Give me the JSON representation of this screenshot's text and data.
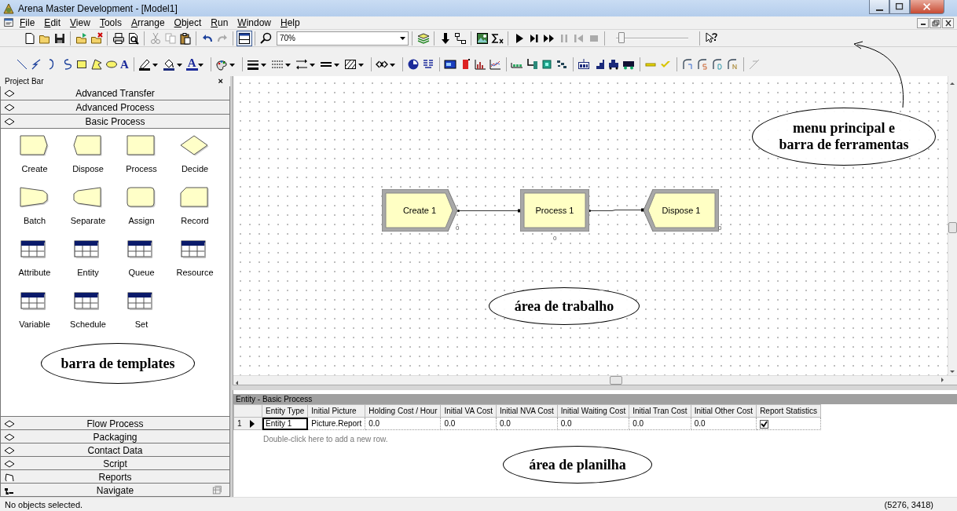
{
  "window": {
    "title": "Arena Master Development - [Model1]"
  },
  "menu": [
    "File",
    "Edit",
    "View",
    "Tools",
    "Arrange",
    "Object",
    "Run",
    "Window",
    "Help"
  ],
  "toolbar": {
    "zoom": "70%",
    "speed_slider": {
      "level": 0.03
    },
    "text_tool": "A",
    "font_color": "A"
  },
  "project_bar": {
    "title": "Project Bar",
    "close": "×",
    "panels_top": [
      {
        "label": "Advanced Transfer"
      },
      {
        "label": "Advanced Process"
      },
      {
        "label": "Basic Process",
        "modules": [
          {
            "label": "Create",
            "kind": "create"
          },
          {
            "label": "Dispose",
            "kind": "dispose"
          },
          {
            "label": "Process",
            "kind": "process"
          },
          {
            "label": "Decide",
            "kind": "decide"
          },
          {
            "label": "Batch",
            "kind": "batch"
          },
          {
            "label": "Separate",
            "kind": "separate"
          },
          {
            "label": "Assign",
            "kind": "assign"
          },
          {
            "label": "Record",
            "kind": "record"
          },
          {
            "label": "Attribute",
            "kind": "data"
          },
          {
            "label": "Entity",
            "kind": "data"
          },
          {
            "label": "Queue",
            "kind": "data"
          },
          {
            "label": "Resource",
            "kind": "data"
          },
          {
            "label": "Variable",
            "kind": "data"
          },
          {
            "label": "Schedule",
            "kind": "data"
          },
          {
            "label": "Set",
            "kind": "data"
          }
        ]
      }
    ],
    "panels_bottom": [
      {
        "label": "Flow Process",
        "kind": "template"
      },
      {
        "label": "Packaging",
        "kind": "template"
      },
      {
        "label": "Contact Data",
        "kind": "template"
      },
      {
        "label": "Script",
        "kind": "template"
      },
      {
        "label": "Reports",
        "kind": "reports"
      },
      {
        "label": "Navigate",
        "kind": "navigate"
      }
    ]
  },
  "canvas": {
    "nodes": [
      {
        "label": "Create 1",
        "kind": "create",
        "count": "0"
      },
      {
        "label": "Process 1",
        "kind": "process",
        "count": "0"
      },
      {
        "label": "Dispose 1",
        "kind": "dispose",
        "count": "0"
      }
    ]
  },
  "spreadsheet": {
    "title": "Entity - Basic Process",
    "columns": [
      "Entity Type",
      "Initial Picture",
      "Holding Cost / Hour",
      "Initial VA Cost",
      "Initial NVA Cost",
      "Initial Waiting Cost",
      "Initial Tran Cost",
      "Initial Other Cost",
      "Report Statistics"
    ],
    "rows": [
      {
        "number": "1",
        "current": true,
        "cells": [
          "Entity 1",
          "Picture.Report",
          "0.0",
          "0.0",
          "0.0",
          "0.0",
          "0.0",
          "0.0"
        ],
        "report_statistics": true
      }
    ],
    "add_row_hint": "Double-click here to add a new row."
  },
  "status_bar": {
    "message": "No objects selected.",
    "coordinates": "(5276, 3418)"
  },
  "annotations": [
    {
      "text": "menu principal e\nbarra de ferramentas",
      "pointer": true
    },
    {
      "text": "área de trabalho",
      "pointer": false
    },
    {
      "text": "barra de templates",
      "pointer": false
    },
    {
      "text": "área de planilha",
      "pointer": false
    }
  ]
}
